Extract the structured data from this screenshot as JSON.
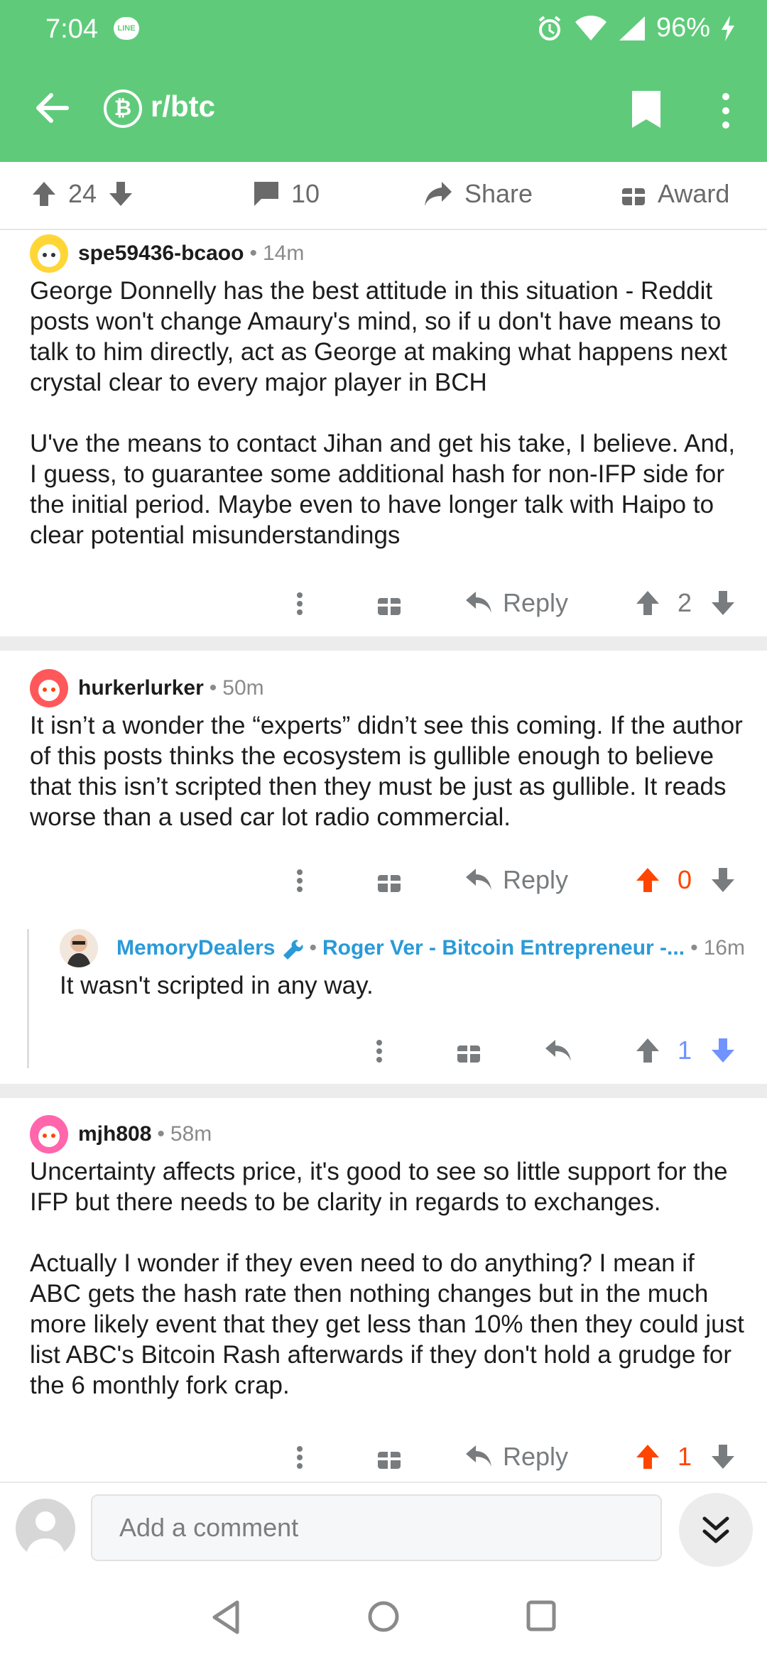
{
  "status_bar": {
    "time": "7:04",
    "battery": "96%"
  },
  "app_bar": {
    "subreddit": "r/btc"
  },
  "post_actions": {
    "upvotes": "24",
    "comments": "10",
    "share": "Share",
    "award": "Award"
  },
  "comments": [
    {
      "user": "spe59436-bcaoo",
      "time": "14m",
      "paragraphs": [
        "George Donnelly has the best attitude in this situation - Reddit posts won't change Amaury's mind, so if u don't have means to talk to him directly, act as George at making what happens next crystal clear to every major player in BCH",
        "U've the means to contact Jihan and get his take, I believe. And, I guess, to guarantee some additional hash for non-IFP side for the initial period. Maybe even to have longer talk with Haipo to clear potential misunderstandings"
      ],
      "reply_label": "Reply",
      "score": "2"
    },
    {
      "user": "hurkerlurker",
      "time": "50m",
      "paragraphs": [
        "It isn’t a wonder the “experts” didn’t  see this coming. If the author of this posts thinks the ecosystem is gullible enough to believe that this isn’t scripted then they must be just as gullible. It reads worse than a used car lot radio commercial."
      ],
      "reply_label": "Reply",
      "score": "0",
      "reply": {
        "user": "MemoryDealers",
        "flair": "Roger Ver - Bitcoin Entrepreneur -...",
        "time": "16m",
        "text": "It wasn't scripted in any way.",
        "score": "1"
      }
    },
    {
      "user": "mjh808",
      "time": "58m",
      "paragraphs": [
        "Uncertainty affects price, it's good to see so little support for the IFP but there needs to be clarity in regards to exchanges.",
        "Actually I wonder if they even need to do anything? I mean if ABC gets the hash rate then nothing changes but in the much more likely event that they get less than 10% then they could just list ABC's Bitcoin Rash afterwards if they don't hold a grudge for the 6 monthly fork crap."
      ],
      "reply_label": "Reply",
      "score": "1"
    }
  ],
  "composer": {
    "placeholder": "Add a comment"
  },
  "colors": {
    "brand": "#5fcb7a",
    "upvote": "#ff4500",
    "downvote": "#7193ff",
    "link": "#2a9ad8"
  },
  "icons": [
    "line-icon",
    "alarm-icon",
    "wifi-icon",
    "signal-icon",
    "charging-icon",
    "back-arrow-icon",
    "bitcoin-icon",
    "bookmark-icon",
    "more-vert-icon",
    "upvote-icon",
    "downvote-icon",
    "comment-icon",
    "share-icon",
    "award-icon",
    "reply-icon",
    "mod-wrench-icon",
    "collapse-icon"
  ]
}
